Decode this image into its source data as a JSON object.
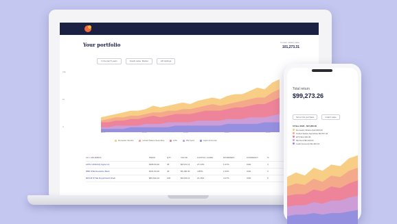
{
  "colors": {
    "background": "#c4c7f0",
    "header": "#1b2143",
    "series": [
      "#f7c97a",
      "#f4a58c",
      "#ec7f9a",
      "#c8a0dd",
      "#8f8ee0"
    ]
  },
  "laptop": {
    "logo_icon": "brand-logo-icon",
    "page_title": "Your portfolio",
    "summary_label": "Current market value",
    "summary_value": "101,273.31",
    "filters": [
      "In the last 5 years",
      "Graph value: Market",
      "All holdings"
    ],
    "chart_data": {
      "type": "area",
      "x": [
        0,
        1,
        2,
        3,
        4,
        5,
        6,
        7,
        8,
        9,
        10,
        11,
        12,
        13,
        14,
        15,
        16,
        17,
        18,
        19,
        20,
        21,
        22,
        23,
        24
      ],
      "series": [
        {
          "name": "Domestic Stocks",
          "color": "#f7c97a",
          "values": [
            9,
            10,
            11,
            12,
            13,
            13,
            14,
            16,
            15,
            16,
            17,
            18,
            17,
            19,
            20,
            21,
            20,
            22,
            23,
            23,
            25,
            27,
            26,
            30,
            32
          ]
        },
        {
          "name": "United States Securities",
          "color": "#f4a58c",
          "values": [
            7,
            8,
            9,
            9,
            10,
            10,
            11,
            12,
            12,
            13,
            13,
            14,
            14,
            15,
            16,
            17,
            16,
            17,
            18,
            19,
            20,
            21,
            21,
            24,
            26
          ]
        },
        {
          "name": "ETF",
          "color": "#ec7f9a",
          "values": [
            6,
            6,
            7,
            7,
            8,
            8,
            9,
            10,
            9,
            10,
            11,
            11,
            11,
            12,
            13,
            13,
            13,
            14,
            15,
            15,
            16,
            17,
            17,
            19,
            21
          ]
        },
        {
          "name": "PE Fund",
          "color": "#c8a0dd",
          "values": [
            3,
            3,
            4,
            4,
            4,
            4,
            5,
            5,
            5,
            6,
            6,
            6,
            6,
            7,
            7,
            7,
            7,
            8,
            8,
            8,
            9,
            9,
            9,
            10,
            11
          ]
        },
        {
          "name": "Cash Accounts",
          "color": "#8f8ee0",
          "values": [
            2,
            2,
            2,
            2,
            3,
            3,
            3,
            3,
            3,
            3,
            4,
            4,
            4,
            4,
            4,
            4,
            4,
            5,
            5,
            5,
            5,
            5,
            6,
            6,
            6
          ]
        }
      ],
      "y_ticks": [
        "15k",
        "1k",
        "0"
      ],
      "x_ticks": [
        "2017",
        "2018",
        "2019",
        "2020",
        "2021"
      ],
      "legend_placement": "bottom",
      "grid": false
    },
    "legend": [
      "Domestic Stocks",
      "United States Securities",
      "ETF",
      "PE Fund",
      "Cash Accounts"
    ],
    "table": {
      "headers": [
        "ALL HOLDINGS",
        "PRICE",
        "QTY",
        "VALUE",
        "CAPITAL GAINS",
        "DIVIDENDS",
        "CURRENCY",
        "%"
      ],
      "rows": [
        [
          "APPL NASDAQ Apple Inc.",
          "$186.50.20",
          "35",
          "$6,572.13",
          "27.13%",
          "1.07%",
          "USD",
          "4"
        ],
        [
          "DBD NSE Deutsche Bank",
          "$161.50.00",
          "40",
          "$6,460.00",
          "4.85%",
          "1.00%",
          "USD",
          "3"
        ],
        [
          "RDS.B NYSE Royal Dutch Shell",
          "$83,640.19",
          "108",
          "$9,033.14",
          "21.46%",
          "4.27%",
          "USD",
          "5"
        ]
      ]
    }
  },
  "phone": {
    "total_label": "Total return",
    "total_value": "$99,273.26",
    "filters": [
      "Since first purchase",
      "Graph value"
    ],
    "legend_date": "15 Nov 2020 · $37,956.00",
    "legend_rows": [
      {
        "label": "Domestic Shares $12,956.00",
        "color": "#f7c97a"
      },
      {
        "label": "United States Securities $3,567.32",
        "color": "#f4a58c"
      },
      {
        "label": "ETF $11,330.06",
        "color": "#ec7f9a"
      },
      {
        "label": "PE Fund $6,340.01",
        "color": "#c8a0dd"
      },
      {
        "label": "Cash Accounts $3,462.01",
        "color": "#8f8ee0"
      }
    ],
    "chart_data": {
      "type": "area",
      "x": [
        0,
        1,
        2,
        3,
        4,
        5,
        6,
        7,
        8
      ],
      "series": [
        {
          "name": "Domestic Shares",
          "values": [
            30,
            33,
            31,
            36,
            34,
            38,
            37,
            42,
            44
          ]
        },
        {
          "name": "United States Securities",
          "values": [
            24,
            26,
            25,
            29,
            27,
            31,
            30,
            34,
            36
          ]
        },
        {
          "name": "ETF",
          "values": [
            18,
            19,
            19,
            22,
            21,
            24,
            23,
            26,
            28
          ]
        },
        {
          "name": "PE Fund",
          "values": [
            11,
            12,
            12,
            14,
            13,
            15,
            15,
            17,
            18
          ]
        },
        {
          "name": "Cash Accounts",
          "values": [
            5,
            6,
            6,
            7,
            6,
            7,
            7,
            8,
            9
          ]
        }
      ]
    }
  }
}
